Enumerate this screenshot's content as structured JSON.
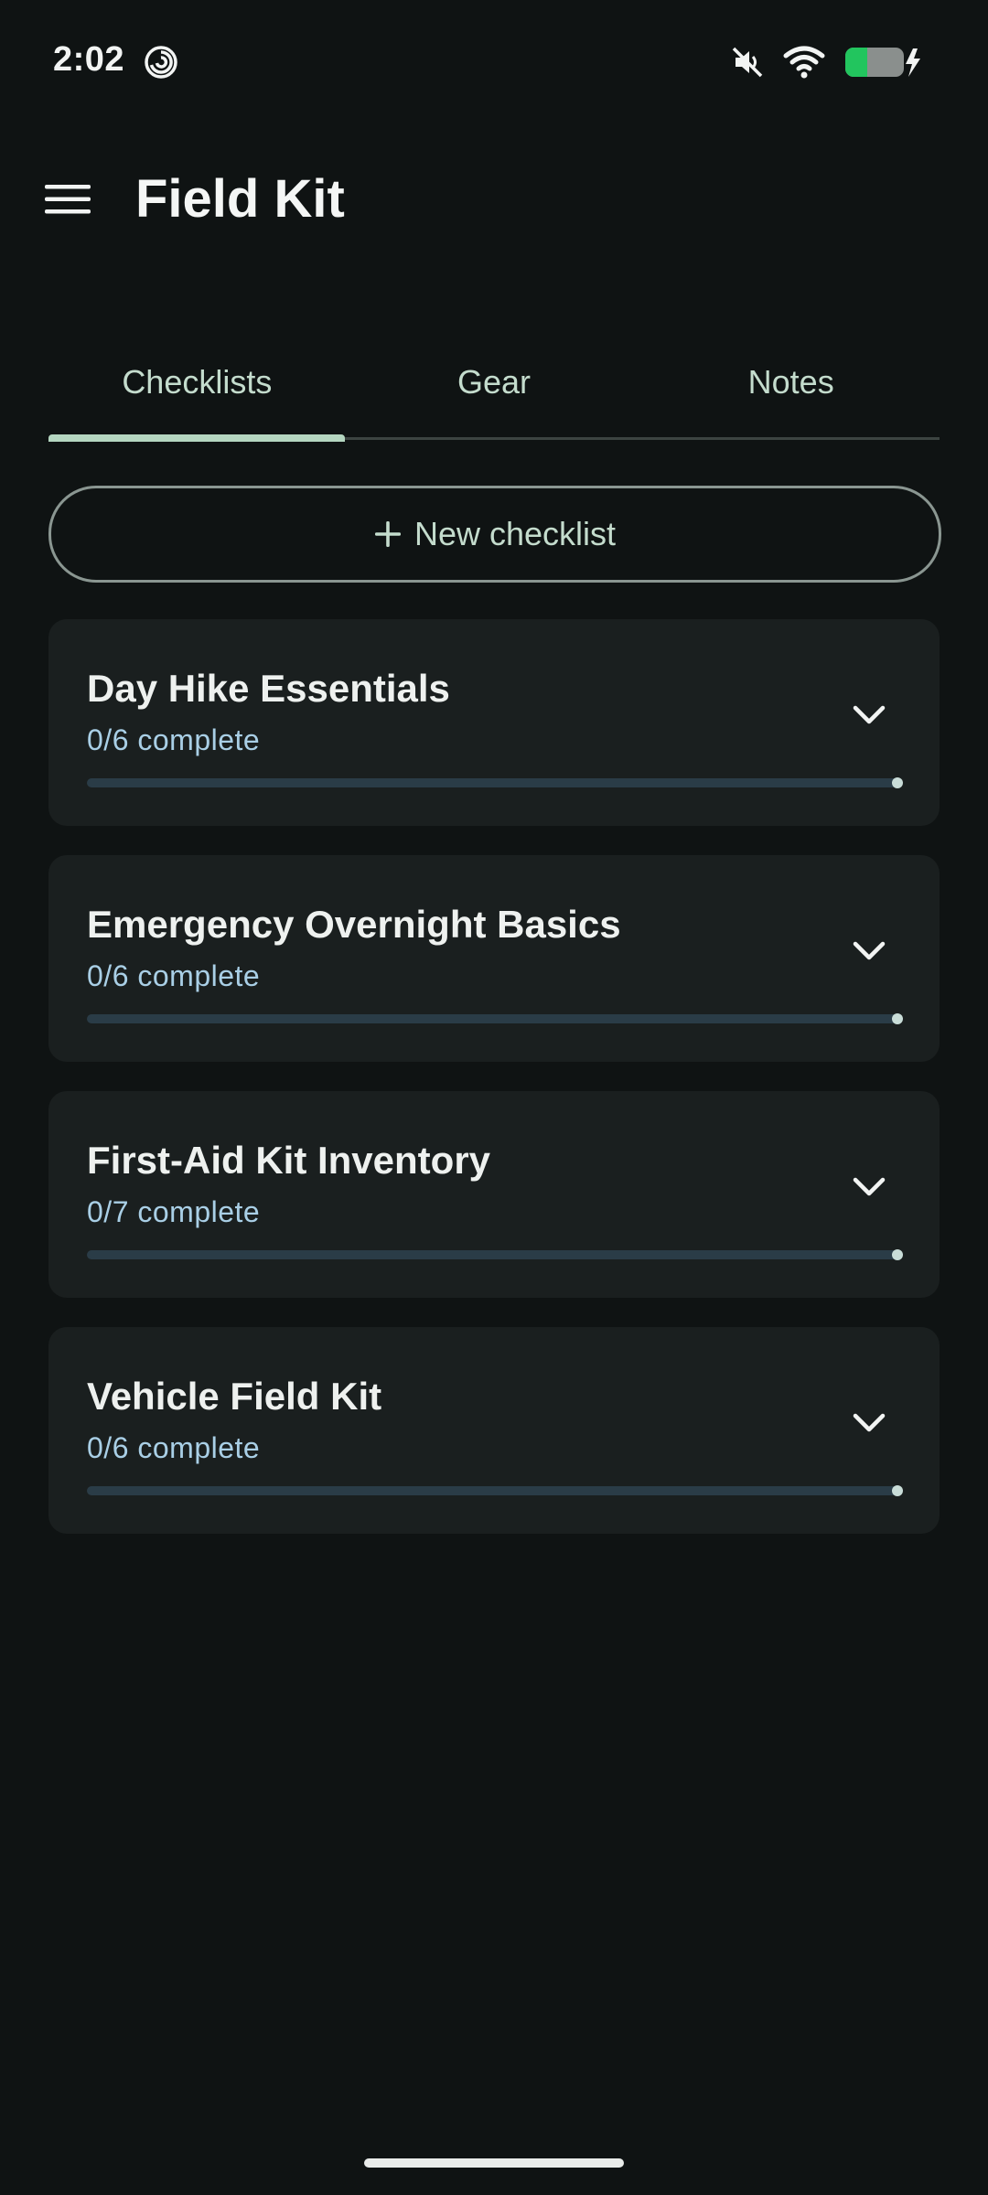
{
  "status_bar": {
    "time": "2:02",
    "icons": [
      "spiral-icon",
      "mute-icon",
      "wifi-icon",
      "battery-charging-icon"
    ],
    "battery_color": "#22c55e"
  },
  "app_bar": {
    "menu_icon": "menu-icon",
    "title": "Field Kit"
  },
  "tabs": [
    {
      "label": "Checklists",
      "selected": true
    },
    {
      "label": "Gear",
      "selected": false
    },
    {
      "label": "Notes",
      "selected": false
    }
  ],
  "new_checklist": {
    "icon": "plus-icon",
    "label": "New checklist"
  },
  "checklists": [
    {
      "title": "Day Hike Essentials",
      "progress_text": "0/6 complete",
      "done": 0,
      "total": 6
    },
    {
      "title": "Emergency Overnight Basics",
      "progress_text": "0/6 complete",
      "done": 0,
      "total": 6
    },
    {
      "title": "First-Aid Kit Inventory",
      "progress_text": "0/7 complete",
      "done": 0,
      "total": 7
    },
    {
      "title": "Vehicle Field Kit",
      "progress_text": "0/6 complete",
      "done": 0,
      "total": 6
    }
  ],
  "colors": {
    "background": "#0f1313",
    "card": "#1a1f1f",
    "accent": "#b4d6c0",
    "progress_text": "#a9cfe6",
    "progress_track": "#2a3c47"
  }
}
